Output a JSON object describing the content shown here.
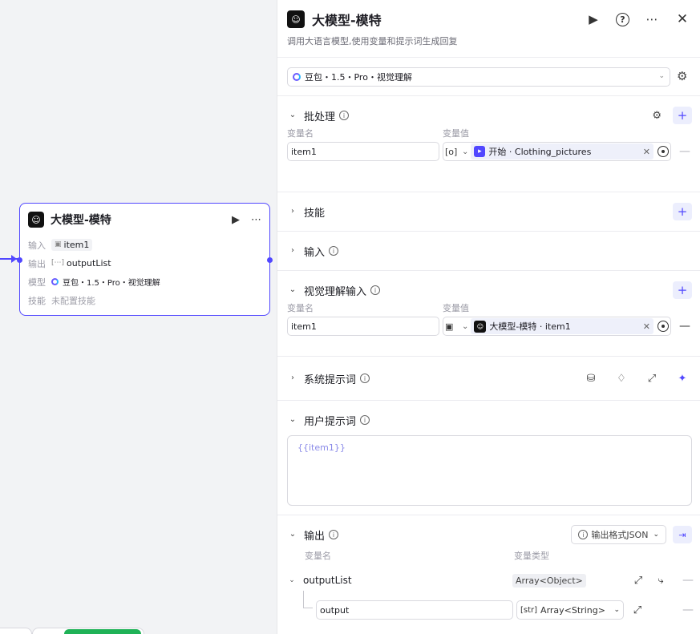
{
  "canvas": {
    "node": {
      "title": "大模型-模特",
      "rows": [
        {
          "label": "输入",
          "value": "item1",
          "icon": "image-icon"
        },
        {
          "label": "输出",
          "value": "outputList",
          "icon": "array-icon"
        },
        {
          "label": "模型",
          "value": "豆包・1.5・Pro・视觉理解",
          "icon": "doubao-icon"
        },
        {
          "label": "技能",
          "value": "未配置技能"
        }
      ]
    }
  },
  "panel": {
    "title": "大模型-模特",
    "description": "调用大语言模型,使用变量和提示词生成回复",
    "model": "豆包・1.5・Pro・视觉理解",
    "batch": {
      "title": "批处理",
      "col_name": "变量名",
      "col_value": "变量值",
      "row": {
        "name": "item1",
        "type_icon": "[o]",
        "source": "开始",
        "var": "Clothing_pictures"
      }
    },
    "skills": {
      "title": "技能"
    },
    "input": {
      "title": "输入"
    },
    "vision": {
      "title": "视觉理解输入",
      "col_name": "变量名",
      "col_value": "变量值",
      "row": {
        "name": "item1",
        "source": "大模型-模特",
        "var": "item1"
      }
    },
    "system_prompt": {
      "title": "系统提示词"
    },
    "user_prompt": {
      "title": "用户提示词",
      "content": "{{item1}}"
    },
    "output": {
      "title": "输出",
      "format_label": "输出格式JSON",
      "col_name": "变量名",
      "col_type": "变量类型",
      "items": [
        {
          "name": "outputList",
          "type": "Array<Object>"
        }
      ],
      "sub": {
        "name": "output",
        "type": "Array<String>",
        "type_icon": "[str]"
      }
    }
  }
}
